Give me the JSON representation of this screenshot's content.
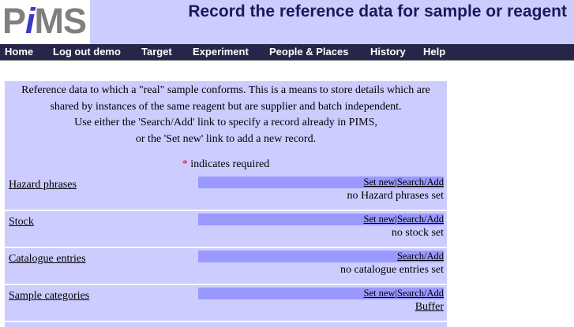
{
  "header": {
    "logo_prefix": "P",
    "logo_i": "i",
    "logo_suffix": "MS",
    "title": "Record the reference data for sample or reagent"
  },
  "nav": [
    "Home",
    "Log out demo",
    "Target",
    "Experiment",
    "People & Places",
    "History",
    "Help"
  ],
  "intro": {
    "line1": "Reference data to which a \"real\" sample conforms. This is a means to store details which are",
    "line2": "shared by instances of the same reagent but are supplier and batch independent.",
    "line3": "Use either the 'Search/Add' link to specify a record already in PIMS,",
    "line4": "or the 'Set new' link to add a new record."
  },
  "required": {
    "star": "*",
    "text": " indicates required"
  },
  "rows": [
    {
      "label": "Hazard phrases",
      "set_new": "Set new",
      "sep": "|",
      "search_add": "Search/Add",
      "value": "no Hazard phrases set"
    },
    {
      "label": "Stock",
      "set_new": "Set new",
      "sep": "|",
      "search_add": "Search/Add",
      "value": "no stock set"
    },
    {
      "label": "Catalogue entries",
      "search_add": "Search/Add",
      "value": "no catalogue entries set"
    },
    {
      "label": "Sample categories",
      "set_new": "Set new",
      "sep": "|",
      "search_add": "Search/Add",
      "value": "Buffer"
    }
  ]
}
